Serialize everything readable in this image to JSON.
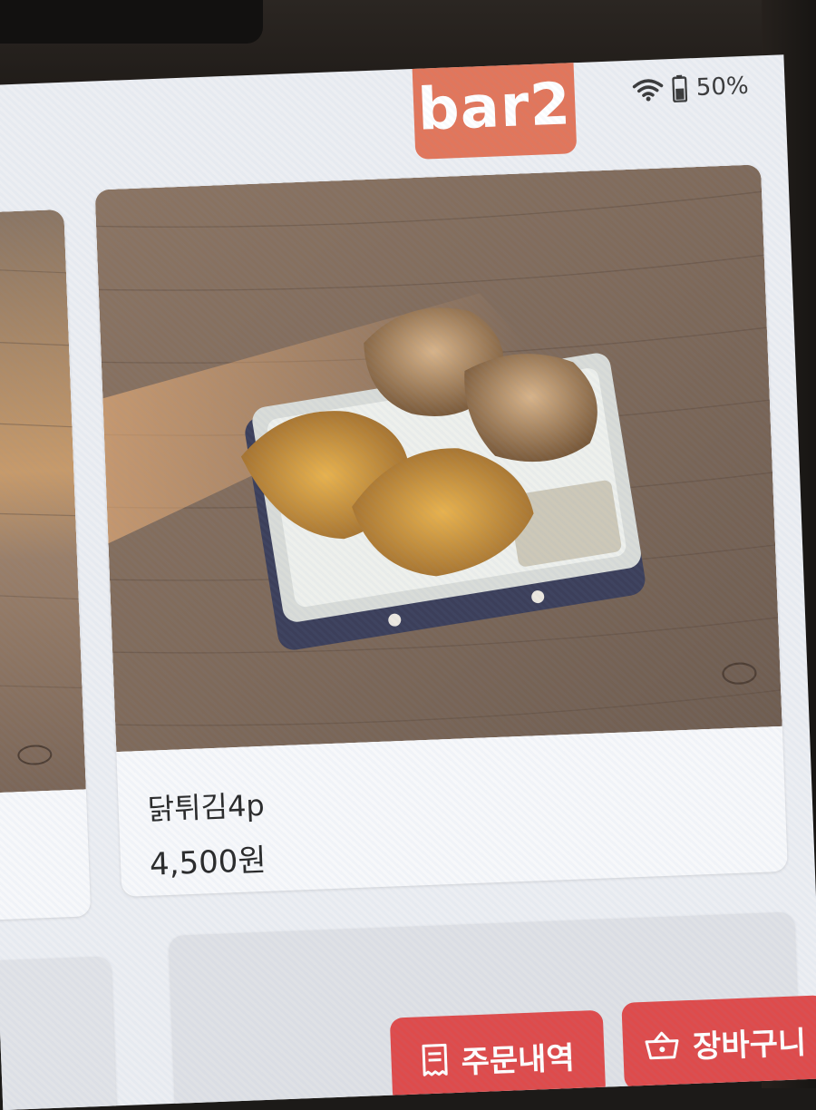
{
  "status": {
    "wifi_icon": "wifi-icon",
    "battery_icon": "battery-icon",
    "battery_text": "50%"
  },
  "header": {
    "table_label": "bar2",
    "badge_color": "#e2765b"
  },
  "menu": {
    "featured_item": {
      "name": "닭튀김4p",
      "price": "4,500원"
    }
  },
  "actions": {
    "order_history_label": "주문내역",
    "order_history_icon": "receipt-icon",
    "cart_label": "장바구니",
    "cart_icon": "basket-icon",
    "button_color": "#de4b4b"
  }
}
